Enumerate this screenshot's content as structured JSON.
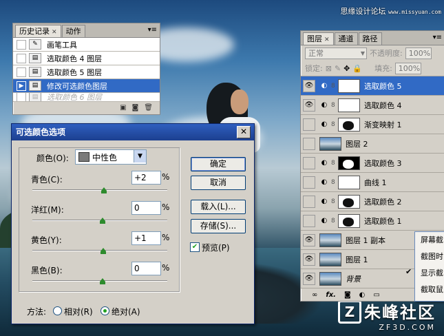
{
  "watermark": {
    "text": "思缘设计论坛",
    "url": "www.missyuan.com"
  },
  "logo": {
    "cn": "朱峰社区",
    "en": "ZF3D.COM",
    "mark": "Z"
  },
  "history_panel": {
    "tabs": [
      {
        "label": "历史记录",
        "active": true
      },
      {
        "label": "动作",
        "active": false
      }
    ],
    "items": [
      {
        "label": "画笔工具",
        "icon": "brush-icon",
        "state": "normal"
      },
      {
        "label": "选取颜色 4 图层",
        "icon": "history-state-icon",
        "state": "normal"
      },
      {
        "label": "选取颜色 5 图层",
        "icon": "history-state-icon",
        "state": "normal"
      },
      {
        "label": "修改可选颜色图层",
        "icon": "history-state-icon",
        "state": "selected"
      },
      {
        "label": "选取颜色 6 图层",
        "icon": "history-state-icon",
        "state": "undone"
      }
    ],
    "footer_icons": [
      "new-document-from-state-icon",
      "camera-snapshot-icon",
      "trash-icon"
    ]
  },
  "layers_panel": {
    "tabs": [
      {
        "label": "图层",
        "active": true
      },
      {
        "label": "通道",
        "active": false
      },
      {
        "label": "路径",
        "active": false
      }
    ],
    "blend_mode": "正常",
    "opacity_label": "不透明度:",
    "opacity_value": "100%",
    "lock_label": "锁定:",
    "fill_label": "填充:",
    "fill_value": "100%",
    "layers": [
      {
        "name": "选取颜色 5",
        "type": "adjustment",
        "mask": "white",
        "visible": true,
        "selected": true
      },
      {
        "name": "选取颜色 4",
        "type": "adjustment",
        "mask": "white",
        "visible": true,
        "selected": false
      },
      {
        "name": "渐变映射 1",
        "type": "adjustment",
        "mask": "figure",
        "visible": false,
        "selected": false
      },
      {
        "name": "图层 2",
        "type": "image",
        "visible": false,
        "selected": false
      },
      {
        "name": "选取颜色 3",
        "type": "adjustment",
        "mask": "black",
        "visible": false,
        "selected": false
      },
      {
        "name": "曲线 1",
        "type": "adjustment",
        "mask": "white",
        "visible": false,
        "selected": false
      },
      {
        "name": "选取颜色 2",
        "type": "adjustment",
        "mask": "figure",
        "visible": false,
        "selected": false
      },
      {
        "name": "选取颜色 1",
        "type": "adjustment",
        "mask": "figure",
        "visible": false,
        "selected": false
      },
      {
        "name": "图层 1 副本",
        "type": "image",
        "visible": true,
        "selected": false
      },
      {
        "name": "图层 1",
        "type": "image",
        "visible": true,
        "selected": false
      },
      {
        "name": "背景",
        "type": "image",
        "visible": true,
        "selected": false,
        "italic": true
      }
    ],
    "footer_icons": [
      "link-layers-icon",
      "fx-icon",
      "add-mask-icon",
      "adjustment-layer-icon",
      "group-folder-icon"
    ],
    "footer_fx_label": "fx."
  },
  "context_menu": {
    "items": [
      {
        "label": "屏幕截",
        "checked": false
      },
      {
        "label": "截图时",
        "checked": false
      },
      {
        "label": "显示截",
        "checked": true
      },
      {
        "label": "截取鼠",
        "checked": false
      }
    ]
  },
  "dialog": {
    "title": "可选颜色选项",
    "colors_label": "颜色(O):",
    "color_value": "中性色",
    "sliders": [
      {
        "label": "青色(C):",
        "value": "+2",
        "unit": "%",
        "level": 2
      },
      {
        "label": "洋红(M):",
        "value": "0",
        "unit": "%",
        "level": 0
      },
      {
        "label": "黄色(Y):",
        "value": "+1",
        "unit": "%",
        "level": 1
      },
      {
        "label": "黑色(B):",
        "value": "0",
        "unit": "%",
        "level": 0
      }
    ],
    "buttons": {
      "ok": "确定",
      "cancel": "取消",
      "load": "载入(L)...",
      "save": "存储(S)..."
    },
    "preview": {
      "label": "预览(P)",
      "checked": true
    },
    "method_label": "方法:",
    "method_options": [
      {
        "label": "相对(R)",
        "checked": false
      },
      {
        "label": "绝对(A)",
        "checked": true
      }
    ]
  }
}
